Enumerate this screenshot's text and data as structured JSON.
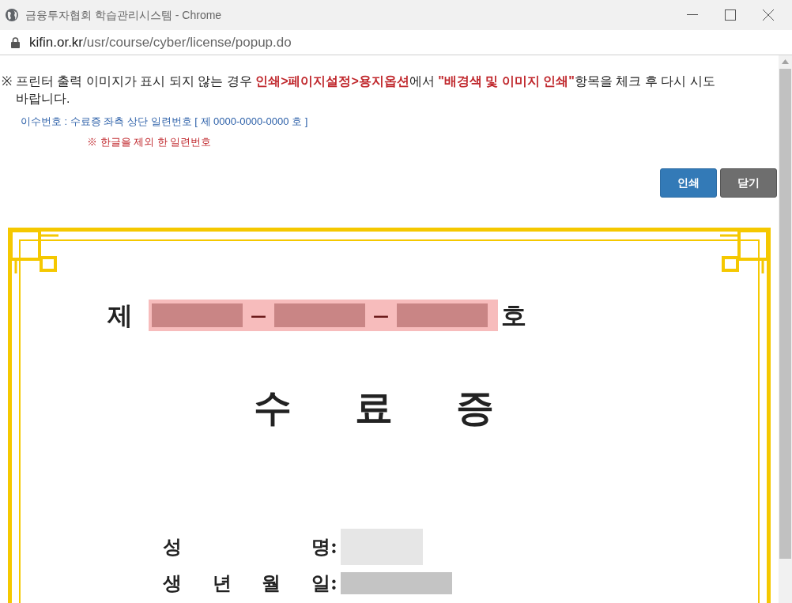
{
  "window": {
    "title": "금융투자협회 학습관리시스템 - Chrome",
    "url_host": "kifin.or.kr",
    "url_path": "/usr/course/cyber/license/popup.do"
  },
  "notice": {
    "mark": "※",
    "segments": [
      {
        "text": "프린터 출력 이미지가 표시 되지 않는 경우 ",
        "emphasis": false
      },
      {
        "text": "인쇄>페이지설정>용지옵션",
        "emphasis": true
      },
      {
        "text": "에서 ",
        "emphasis": false
      },
      {
        "text": "\"배경색 및 이미지 인쇄\"",
        "emphasis": true
      },
      {
        "text": "항목을 체크 후 다시 시도 바랍니다.",
        "emphasis": false
      }
    ]
  },
  "serial_hint": "이수번호 : 수료증 좌측 상단 일련번호 [ 제 0000-0000-0000 호 ]",
  "serial_note": "※ 한글을 제외 한 일련번호",
  "buttons": [
    {
      "label": "인쇄",
      "kind": "primary"
    },
    {
      "label": "닫기",
      "kind": "secondary"
    }
  ],
  "certificate": {
    "number_prefix": "제",
    "number_parts": [
      {
        "kind": "redacted"
      },
      {
        "kind": "dash",
        "text": "—"
      },
      {
        "kind": "redacted"
      },
      {
        "kind": "dash",
        "text": "—"
      },
      {
        "kind": "redacted"
      }
    ],
    "number_suffix": "호",
    "title_chars": [
      "수",
      "료",
      "증"
    ],
    "fields": [
      {
        "label_chars": [
          "성",
          "명"
        ],
        "colon": ":",
        "value_dark": false
      },
      {
        "label_chars": [
          "생",
          "년",
          "월",
          "일"
        ],
        "colon": ":",
        "value_dark": true
      }
    ]
  }
}
